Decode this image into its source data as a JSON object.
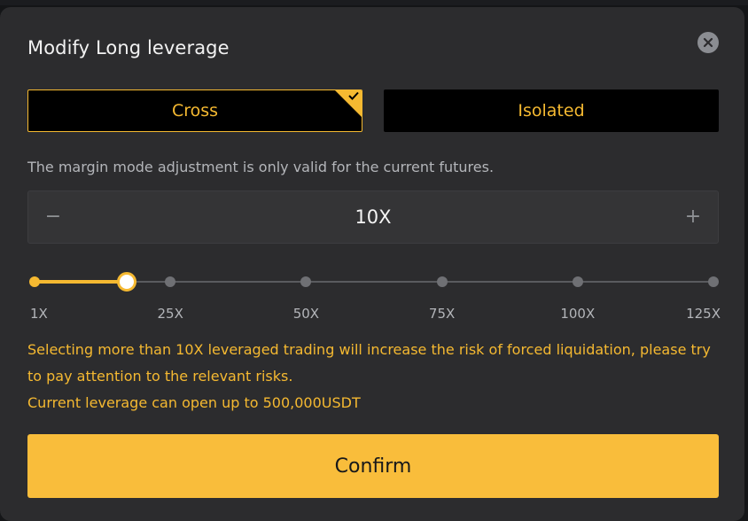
{
  "modal": {
    "title": "Modify Long leverage"
  },
  "margin_mode": {
    "options": [
      {
        "label": "Cross",
        "selected": true
      },
      {
        "label": "Isolated",
        "selected": false
      }
    ],
    "note": "The margin mode adjustment is only valid for the current futures."
  },
  "leverage": {
    "value_label": "10X",
    "value": 10,
    "minus_symbol": "−",
    "plus_symbol": "+",
    "min": 1,
    "max": 125,
    "ticks": [
      "1X",
      "25X",
      "50X",
      "75X",
      "100X",
      "125X"
    ]
  },
  "warning": {
    "line1": "Selecting more than 10X leveraged trading will increase the risk of forced liquidation, please try to pay attention to the relevant risks.",
    "line2": "Current leverage can open up to 500,000USDT"
  },
  "actions": {
    "confirm_label": "Confirm"
  },
  "colors": {
    "accent": "#f5b931",
    "modal_bg": "#2c2c2e",
    "button_bg": "#000000",
    "text_primary": "#f2f2f2",
    "text_secondary": "#b3b5b9"
  },
  "icons": {
    "close": "close-icon",
    "selected": "check-icon"
  }
}
